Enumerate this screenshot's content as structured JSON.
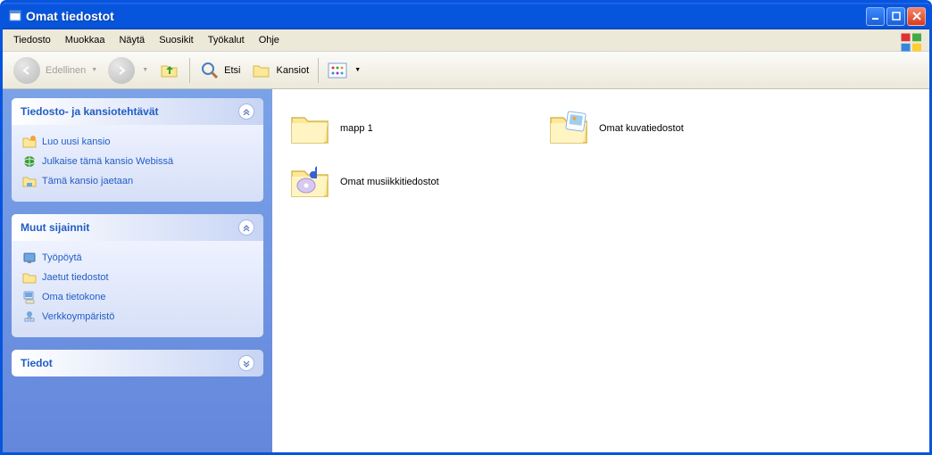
{
  "window": {
    "title": "Omat tiedostot"
  },
  "menubar": {
    "items": [
      "Tiedosto",
      "Muokkaa",
      "Näytä",
      "Suosikit",
      "Työkalut",
      "Ohje"
    ]
  },
  "toolbar": {
    "back": "Edellinen",
    "search": "Etsi",
    "folders": "Kansiot"
  },
  "sidebar": {
    "panels": [
      {
        "title": "Tiedosto- ja kansiotehtävät",
        "items": [
          {
            "label": "Luo uusi kansio",
            "icon": "new-folder"
          },
          {
            "label": "Julkaise tämä kansio Webissä",
            "icon": "publish-web"
          },
          {
            "label": "Tämä kansio jaetaan",
            "icon": "share-folder"
          }
        ]
      },
      {
        "title": "Muut sijainnit",
        "items": [
          {
            "label": "Työpöytä",
            "icon": "desktop"
          },
          {
            "label": "Jaetut tiedostot",
            "icon": "shared-docs"
          },
          {
            "label": "Oma tietokone",
            "icon": "my-computer"
          },
          {
            "label": "Verkkoympäristö",
            "icon": "network"
          }
        ]
      },
      {
        "title": "Tiedot",
        "items": []
      }
    ]
  },
  "content": {
    "items": [
      {
        "label": "mapp 1",
        "icon": "folder"
      },
      {
        "label": "Omat kuvatiedostot",
        "icon": "pictures-folder"
      },
      {
        "label": "Omat musiikkitiedostot",
        "icon": "music-folder"
      }
    ]
  }
}
